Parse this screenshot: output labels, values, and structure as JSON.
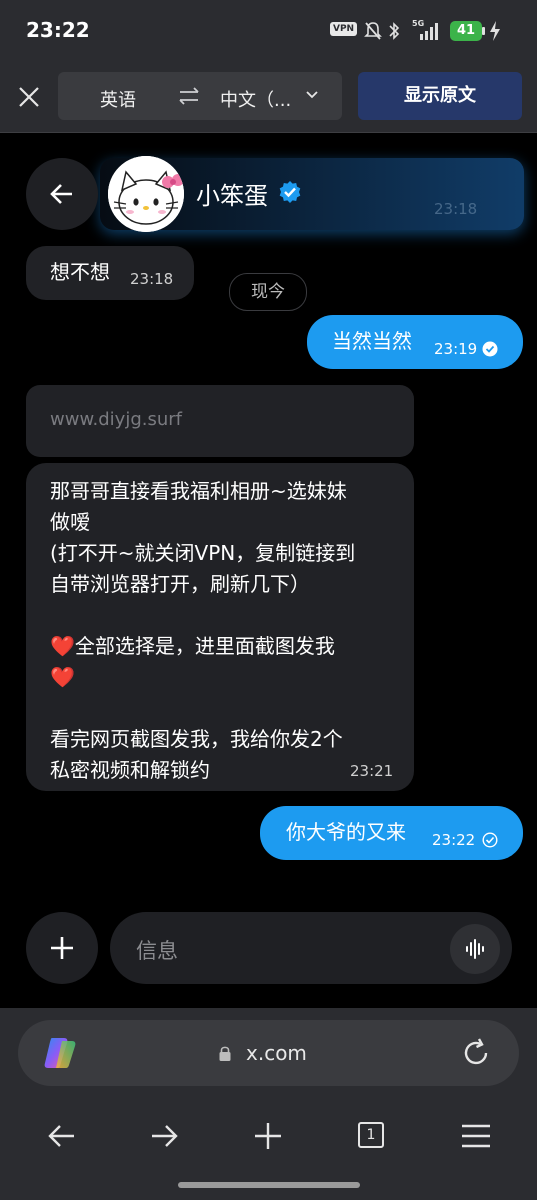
{
  "status_bar": {
    "time": "23:22",
    "vpn_label": "VPN",
    "network": "5G",
    "battery": "41"
  },
  "translate_bar": {
    "source_language": "英语",
    "target_language": "中文（...",
    "show_original_label": "显示原文"
  },
  "chat": {
    "contact_name": "小笨蛋",
    "header_ghost_time": "23:18",
    "divider_label": "现今",
    "messages": [
      {
        "direction": "in",
        "text": "想不想",
        "time": "23:18"
      },
      {
        "direction": "out",
        "text": "当然当然",
        "time": "23:19"
      },
      {
        "direction": "in",
        "text": "www.diyjg.surf",
        "time": ""
      },
      {
        "direction": "in",
        "lines": [
          "那哥哥直接看我福利相册~选妹妹",
          "做嗳",
          "(打不开~就关闭VPN，复制链接到",
          "自带浏览器打开，刷新几下）",
          "",
          "❤️全部选择是，进里面截图发我",
          "❤️",
          "",
          "看完网页截图发我，我给你发2个",
          "私密视频和解锁约"
        ],
        "time": "23:21"
      },
      {
        "direction": "out",
        "text": "你大爷的又来",
        "time": "23:22"
      }
    ]
  },
  "composer": {
    "placeholder": "信息"
  },
  "browser": {
    "url": "x.com",
    "tab_count": "1"
  },
  "colors": {
    "outgoing_bubble": "#1d9bf0",
    "incoming_bubble": "#212226",
    "translate_button": "#26386a",
    "verified_badge": "#1d9bf0"
  }
}
